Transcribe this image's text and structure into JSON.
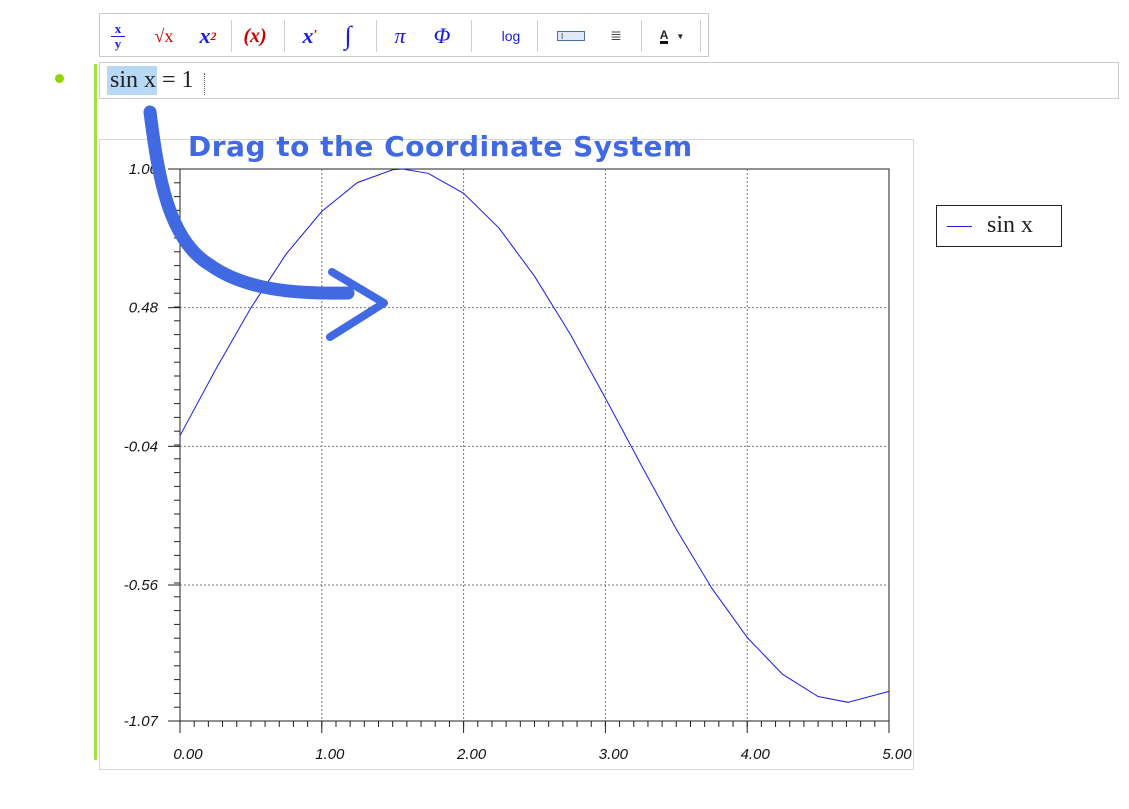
{
  "toolbar": {
    "buttons": [
      {
        "name": "fraction",
        "top": "x",
        "bottom": "y"
      },
      {
        "name": "sqrt",
        "label": "√x"
      },
      {
        "name": "power",
        "label": "x",
        "sup": "2"
      },
      {
        "name": "parentheses",
        "label": "(x)"
      },
      {
        "name": "derivative",
        "label": "x",
        "sup": "′"
      },
      {
        "name": "integral",
        "label": "∫"
      },
      {
        "name": "pi",
        "label": "π"
      },
      {
        "name": "phi",
        "label": "Φ"
      },
      {
        "name": "log",
        "label": "log"
      },
      {
        "name": "textbox",
        "label": "I"
      },
      {
        "name": "align",
        "label": "≣"
      },
      {
        "name": "font-color",
        "label": "A"
      }
    ]
  },
  "input": {
    "selected_text": "sin x",
    "rest_text": " = 1"
  },
  "annotation": "Drag to the Coordinate System",
  "colors": {
    "series": "#1a1ae6",
    "annotation": "#4169e1",
    "selection": "#b9d8f4",
    "accent": "#a3e43a"
  },
  "legend": {
    "label": "sin x"
  },
  "chart_data": {
    "type": "line",
    "title": "",
    "xlabel": "",
    "ylabel": "",
    "xlim": [
      0,
      5
    ],
    "ylim": [
      -1.07,
      1.0
    ],
    "x_ticks": [
      "0.00",
      "1.00",
      "2.00",
      "3.00",
      "4.00",
      "5.00"
    ],
    "y_ticks": [
      "1.00",
      "0.48",
      "-0.04",
      "-0.56",
      "-1.07"
    ],
    "y_tick_values": [
      1.0,
      0.48,
      -0.04,
      -0.56,
      -1.07
    ],
    "grid": true,
    "legend_position": "outside-right",
    "series": [
      {
        "name": "sin x",
        "x": [
          0,
          0.25,
          0.5,
          0.75,
          1.0,
          1.25,
          1.5,
          1.57,
          1.75,
          2.0,
          2.25,
          2.5,
          2.75,
          3.0,
          3.25,
          3.5,
          3.75,
          4.0,
          4.25,
          4.5,
          4.71,
          5.0
        ],
        "y": [
          0.0,
          0.247,
          0.479,
          0.682,
          0.841,
          0.949,
          0.997,
          1.0,
          0.984,
          0.909,
          0.778,
          0.598,
          0.382,
          0.141,
          -0.108,
          -0.351,
          -0.572,
          -0.757,
          -0.895,
          -0.978,
          -1.0,
          -0.959
        ]
      }
    ]
  }
}
